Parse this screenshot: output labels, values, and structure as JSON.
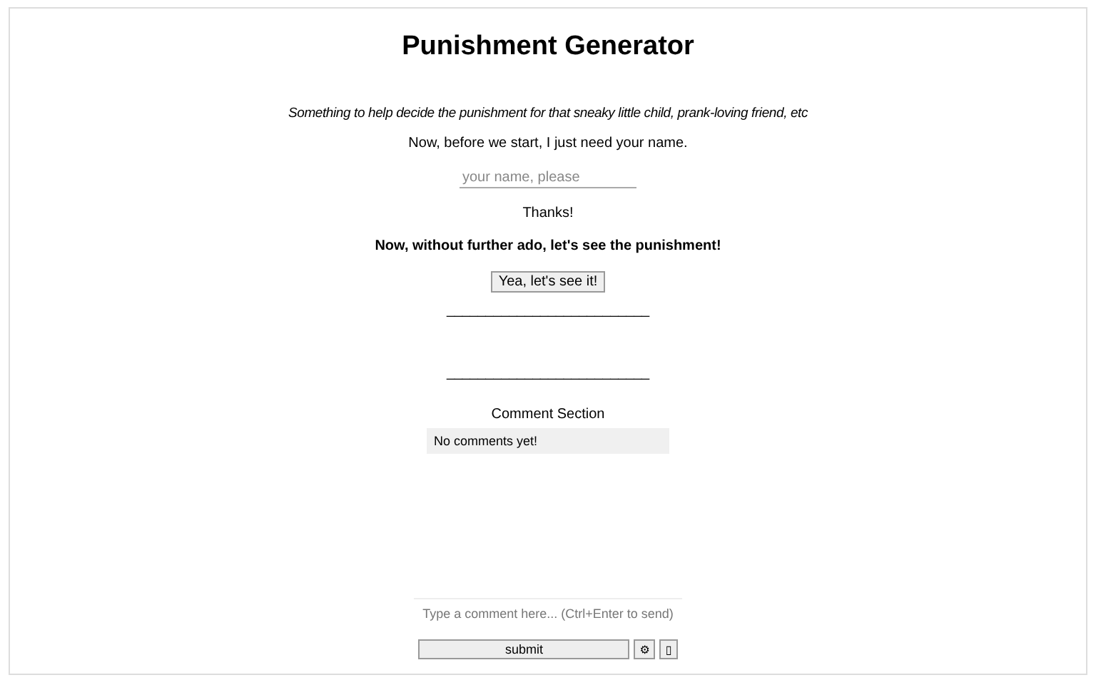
{
  "title": "Punishment Generator",
  "tagline": "Something to help decide the punishment for that sneaky little child, prank-loving friend, etc",
  "name_prompt": "Now, before we start, I just need your name.",
  "name_field": {
    "placeholder": "your name, please"
  },
  "thanks": "Thanks!",
  "lead_in": "Now, without further ado, let's see the punishment!",
  "reveal_button": "Yea, let's see it!",
  "separators": [
    "__________________________",
    "__________________________"
  ],
  "comments": {
    "heading": "Comment Section",
    "empty_text": "No comments yet!",
    "input": {
      "placeholder": "Type a comment here... (Ctrl+Enter to send)"
    },
    "submit": "submit",
    "settings_button": "⚙",
    "extra_button": "▯"
  }
}
